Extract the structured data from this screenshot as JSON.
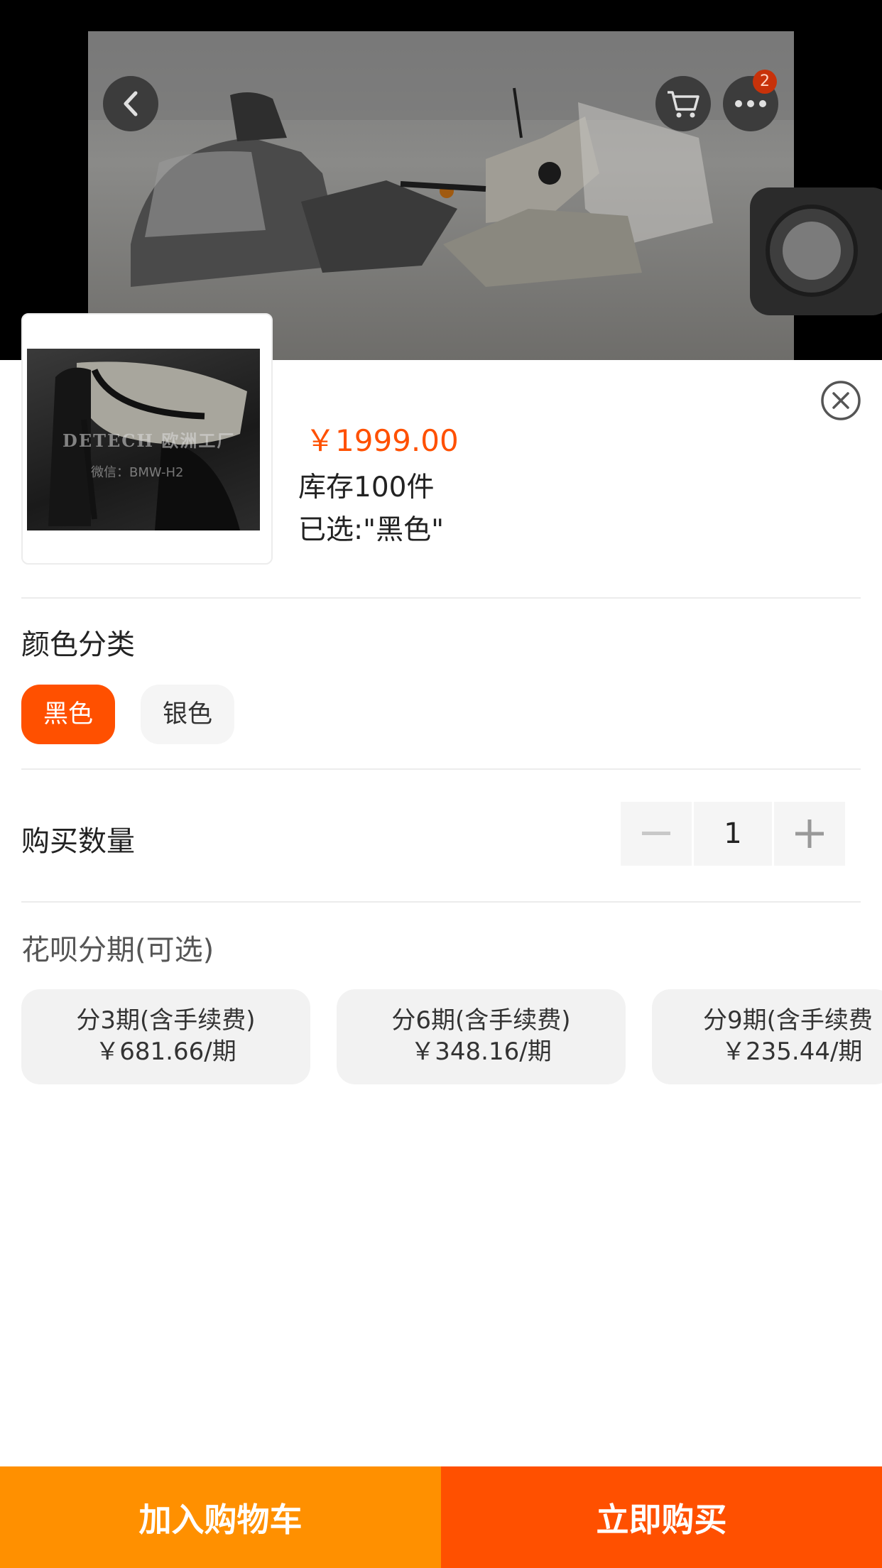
{
  "background": {
    "header_badge": "2",
    "icons": [
      "back-icon",
      "cart-icon",
      "more-icon"
    ]
  },
  "product": {
    "price": "￥1999.00",
    "stock": "库存100件",
    "selected": "已选:\"黑色\"",
    "thumbnail_watermark": "DETECH 欧洲工厂",
    "thumbnail_watermark_sub": "微信：BMW-H2"
  },
  "color_section": {
    "title": "颜色分类",
    "options": [
      {
        "label": "黑色",
        "selected": true
      },
      {
        "label": "银色",
        "selected": false
      }
    ]
  },
  "quantity_section": {
    "title": "购买数量",
    "value": "1"
  },
  "installment_section": {
    "title": "花呗分期(可选)",
    "plans": [
      {
        "line1": "分3期(含手续费)",
        "line2": "￥681.66/期"
      },
      {
        "line1": "分6期(含手续费)",
        "line2": "￥348.16/期"
      },
      {
        "line1": "分9期(含手续费",
        "line2": "￥235.44/期"
      }
    ]
  },
  "footer": {
    "add_to_cart": "加入购物车",
    "buy_now": "立即购买"
  },
  "colors": {
    "accent": "#ff5000",
    "cart_orange": "#ff9000",
    "chip_bg": "#f5f5f5"
  }
}
